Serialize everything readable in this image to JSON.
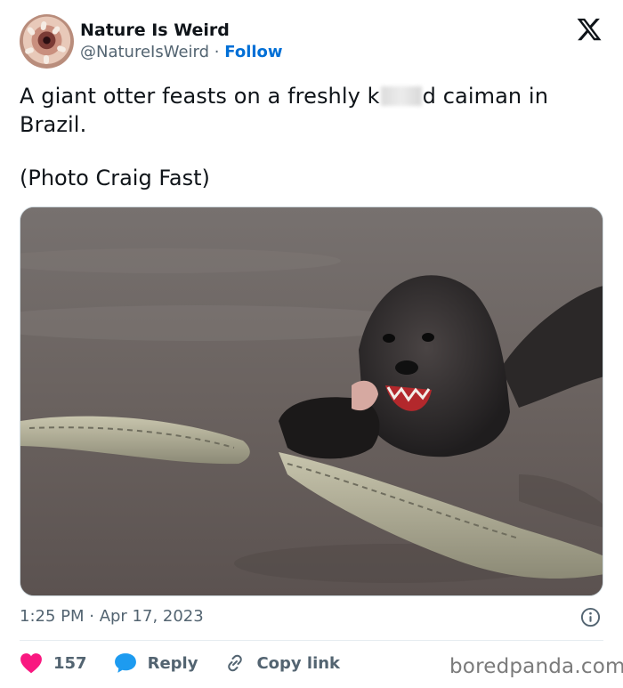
{
  "author": {
    "name": "Nature Is Weird",
    "handle": "@NatureIsWeird",
    "separator": "·",
    "follow_label": "Follow"
  },
  "tweet": {
    "text_line1_before": "A giant otter feasts on a freshly k",
    "text_line1_after": "d caiman in",
    "text_line2": "Brazil.",
    "credit": "(Photo Craig Fast)"
  },
  "timestamp": "1:25 PM · Apr 17, 2023",
  "actions": {
    "likes": "157",
    "reply_label": "Reply",
    "copy_link_label": "Copy link"
  },
  "watermark": "boredpanda.com",
  "icons": {
    "brand": "x-logo-icon",
    "info": "info-icon",
    "like": "heart-icon",
    "reply": "reply-bubble-icon",
    "copy": "link-icon"
  },
  "colors": {
    "follow": "#006fd6",
    "heart": "#f91880",
    "reply": "#1d9bf0",
    "muted": "#536471"
  }
}
